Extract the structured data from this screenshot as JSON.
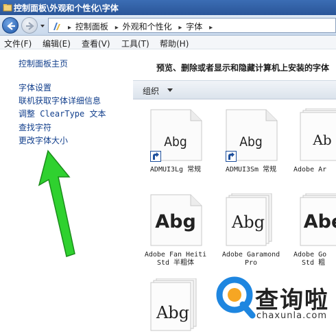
{
  "window": {
    "title": "控制面板\\外观和个性化\\字体"
  },
  "address": {
    "crumbs": [
      "控制面板",
      "外观和个性化",
      "字体"
    ]
  },
  "menu": [
    {
      "label": "文件(F)"
    },
    {
      "label": "编辑(E)"
    },
    {
      "label": "查看(V)"
    },
    {
      "label": "工具(T)"
    },
    {
      "label": "帮助(H)"
    }
  ],
  "sidebar": {
    "home": "控制面板主页",
    "links": [
      "字体设置",
      "联机获取字体详细信息",
      "调整 ClearType 文本",
      "查找字符",
      "更改字体大小"
    ]
  },
  "content": {
    "heading": "预览、删除或者显示和隐藏计算机上安装的字体",
    "toolbar": {
      "organize": "组织"
    },
    "fonts": [
      {
        "preview": "Abg",
        "name_lines": [
          "ADMUI3Lg 常规"
        ],
        "shortcut": true,
        "stacked": false
      },
      {
        "preview": "Abg",
        "name_lines": [
          "ADMUI3Sm 常规"
        ],
        "shortcut": true,
        "stacked": false
      },
      {
        "preview": "Ab",
        "name_lines": [
          "Adobe Ar"
        ],
        "shortcut": false,
        "stacked": true
      },
      {
        "preview": "Abg",
        "name_lines": [
          "Adobe Fan Heiti",
          "Std 半粗体"
        ],
        "shortcut": false,
        "stacked": false
      },
      {
        "preview": "Abg",
        "name_lines": [
          "Adobe Garamond",
          "Pro"
        ],
        "shortcut": false,
        "stacked": true
      },
      {
        "preview": "Abe",
        "name_lines": [
          "Adobe Go",
          "Std 粗"
        ],
        "shortcut": false,
        "stacked": true
      },
      {
        "preview": "Abg",
        "name_lines": [],
        "shortcut": false,
        "stacked": true
      }
    ]
  },
  "watermark": {
    "text": "查询啦",
    "sub": "chaxunla.com"
  },
  "colors": {
    "title_bar": "#2a5598",
    "link": "#123f8c",
    "arrow": "#2fd12f"
  }
}
